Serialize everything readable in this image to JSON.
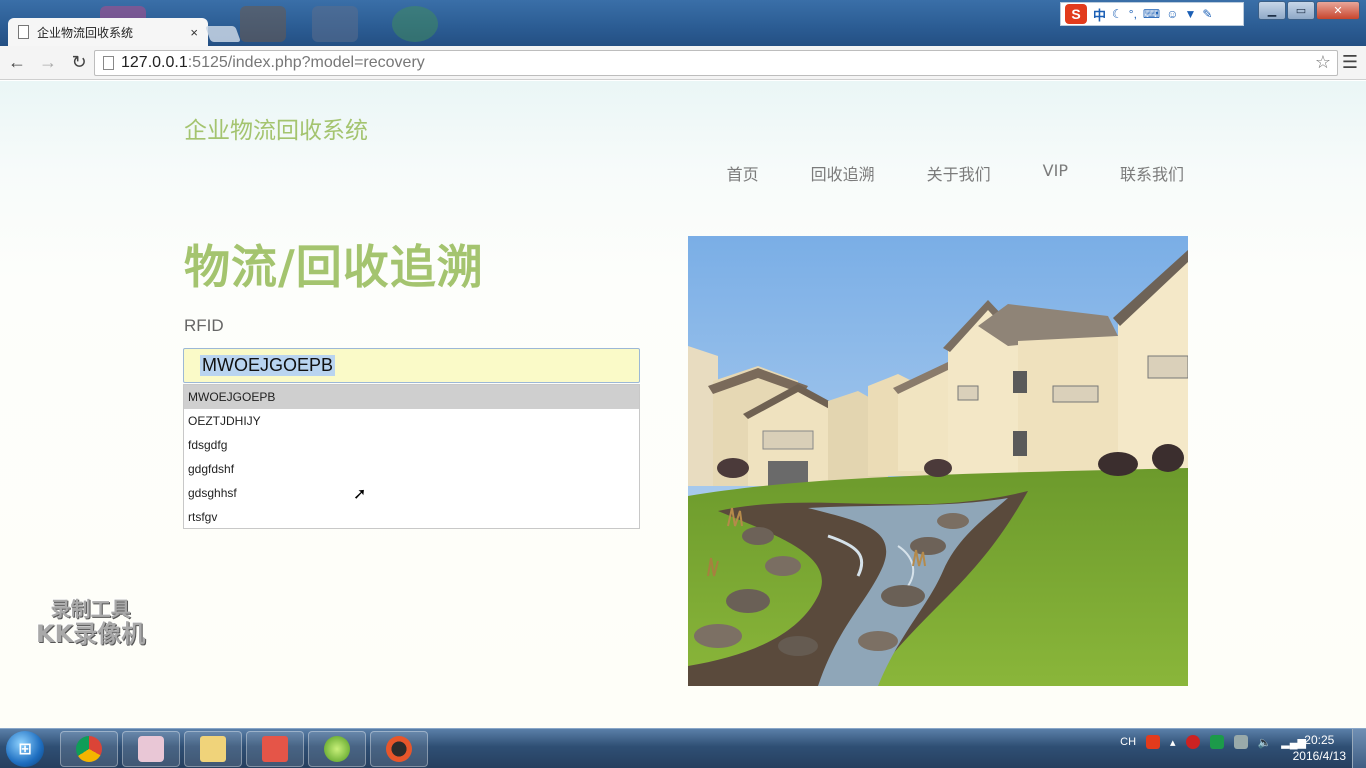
{
  "browser": {
    "tab_title": "企业物流回收系统",
    "tab_close": "×",
    "url_host": "127.0.0.1",
    "url_rest": ":5125/index.php?model=recovery",
    "back_icon": "←",
    "forward_icon": "→",
    "reload_icon": "↻",
    "star_icon": "☆",
    "menu_icon": "☰"
  },
  "ime": {
    "logo": "S",
    "mode": "中",
    "icons": [
      "moon-icon",
      "punctuation-icon",
      "keyboard-icon",
      "person-icon",
      "shirt-icon",
      "wrench-icon"
    ]
  },
  "window_controls": {
    "minimize": "▁",
    "maximize": "▭",
    "close": "✕"
  },
  "site": {
    "title": "企业物流回收系统",
    "nav": [
      "首页",
      "回收追溯",
      "关于我们",
      "VIP",
      "联系我们"
    ]
  },
  "main": {
    "heading": "物流/回收追溯",
    "rfid_label": "RFID",
    "rfid_value": "MWOEJGOEPB",
    "suggestions": [
      "MWOEJGOEPB",
      "OEZTJDHIJY",
      "fdsgdfg",
      "gdgfdshf",
      "gdsghhsf",
      "rtsfgv"
    ]
  },
  "watermark": {
    "line1": "录制工具",
    "line2": "KK录像机"
  },
  "taskbar": {
    "tray_lang": "CH",
    "time": "20:25",
    "date": "2016/4/13"
  }
}
